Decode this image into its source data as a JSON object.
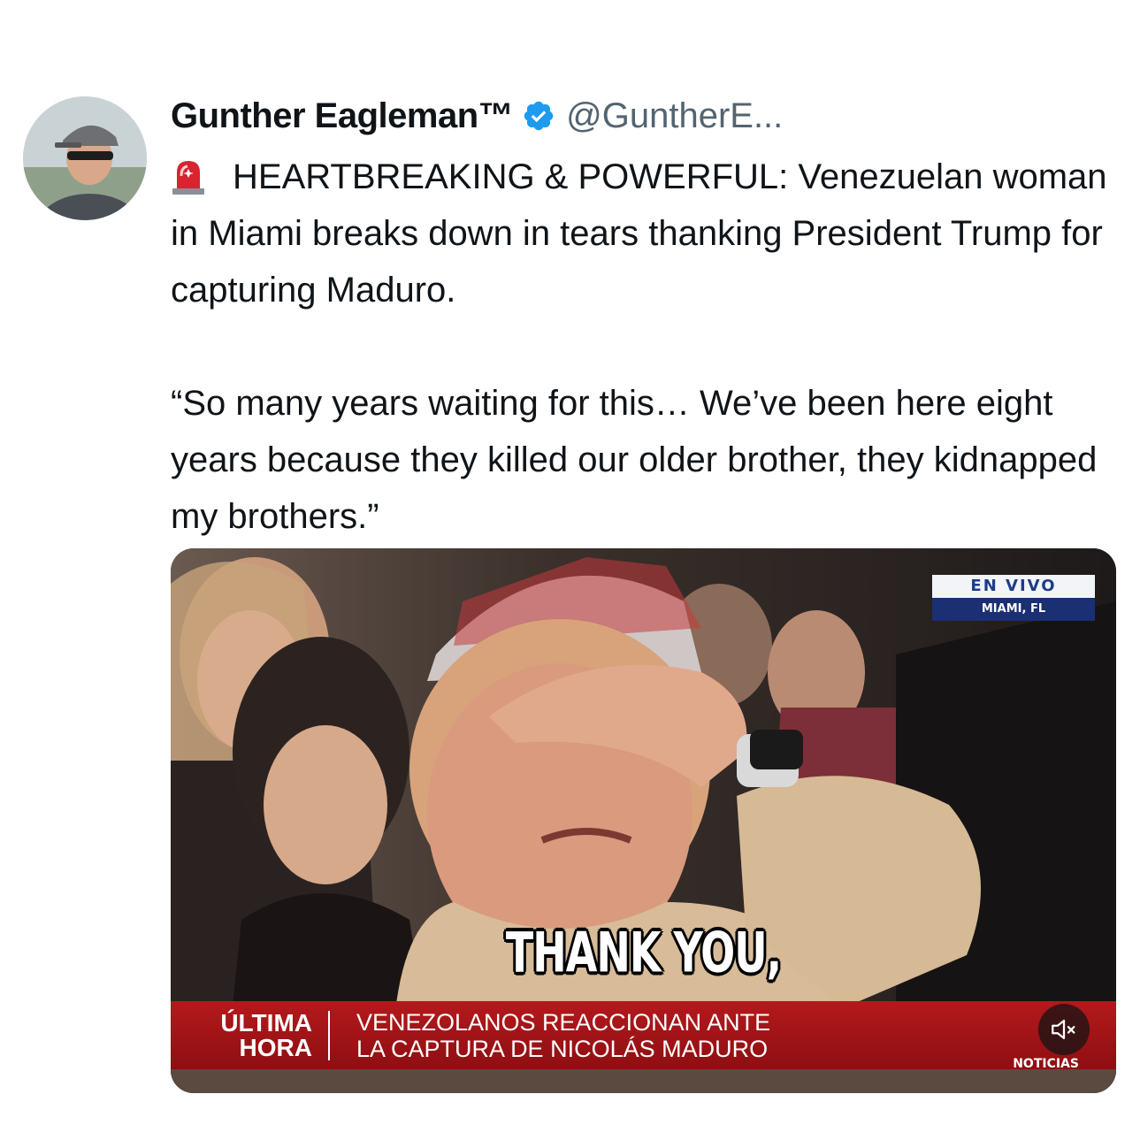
{
  "author": {
    "display_name": "Gunther Eagleman™",
    "handle": "@GuntherE...",
    "verified": true
  },
  "tweet": {
    "lines_paragraph1": "HEARTBREAKING & POWERFUL: Venezuelan woman in Miami breaks down in tears thanking President Trump for capturing Maduro.",
    "lines_paragraph2": "“So many years waiting for this… We’ve been here eight years because they killed our older brother, they kidnapped my brothers.”"
  },
  "media": {
    "live_label": "EN VIVO",
    "location_label": "MIAMI, FL",
    "caption": "THANK YOU,",
    "lower_third_tag_line1": "ÚLTIMA",
    "lower_third_tag_line2": "HORA",
    "headline_line1": "VENEZOLANOS REACCIONAN ANTE",
    "headline_line2": "LA CAPTURA DE NICOLÁS MADURO",
    "brand": "NOTICIAS"
  },
  "icons": {
    "badge": "verified-badge-icon",
    "emoji": "rotating-light-icon",
    "volume": "mute-icon"
  },
  "colors": {
    "verified_blue": "#1d9bf0",
    "handle_gray": "#536471",
    "lower_third_red": "#b4191c",
    "live_navy": "#1b2f73"
  }
}
